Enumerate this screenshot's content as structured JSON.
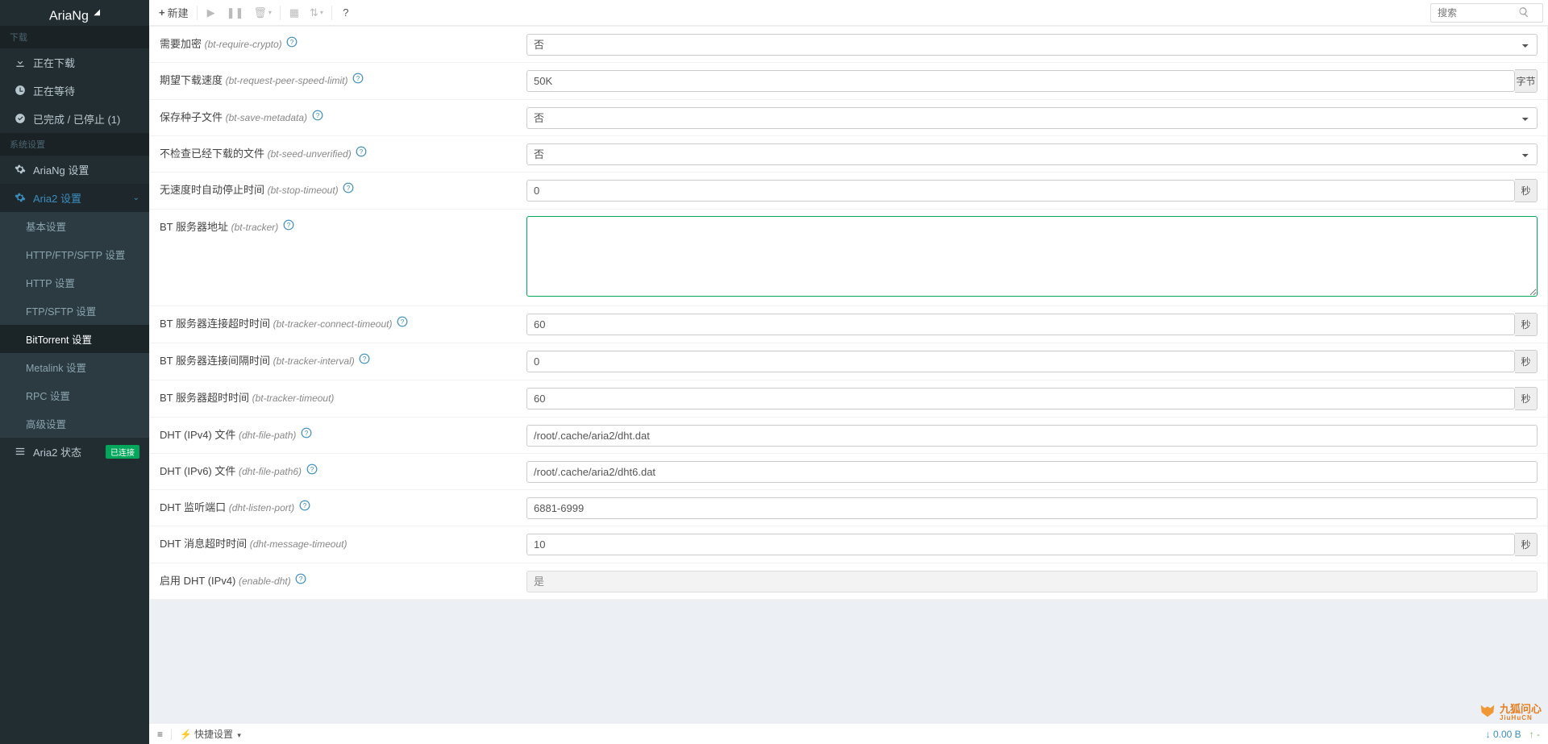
{
  "app": {
    "name": "AriaNg",
    "sublogo": "◢"
  },
  "sidebar": {
    "hdr_downloads": "下载",
    "items_downloads": [
      {
        "label": "正在下载",
        "icon": "download"
      },
      {
        "label": "正在等待",
        "icon": "clock"
      },
      {
        "label": "已完成 / 已停止 (1)",
        "icon": "check"
      }
    ],
    "hdr_system": "系统设置",
    "items_system": [
      {
        "label": "AriaNg 设置",
        "icon": "gear"
      },
      {
        "label": "Aria2 设置",
        "icon": "gear",
        "expanded": true
      },
      {
        "label": "Aria2 状态",
        "icon": "bars",
        "badge": "已连接"
      }
    ],
    "aria2_submenu": [
      "基本设置",
      "HTTP/FTP/SFTP 设置",
      "HTTP 设置",
      "FTP/SFTP 设置",
      "BitTorrent 设置",
      "Metalink 设置",
      "RPC 设置",
      "高级设置"
    ]
  },
  "topbar": {
    "new": "新建",
    "search_placeholder": "搜索"
  },
  "settings": [
    {
      "title": "需要加密",
      "opt": "(bt-require-crypto)",
      "help": true,
      "type": "select",
      "value": "否"
    },
    {
      "title": "期望下载速度",
      "opt": "(bt-request-peer-speed-limit)",
      "help": true,
      "type": "text",
      "value": "50K",
      "unit": "字节"
    },
    {
      "title": "保存种子文件",
      "opt": "(bt-save-metadata)",
      "help": true,
      "type": "select",
      "value": "否"
    },
    {
      "title": "不检查已经下载的文件",
      "opt": "(bt-seed-unverified)",
      "help": true,
      "type": "select",
      "value": "否"
    },
    {
      "title": "无速度时自动停止时间",
      "opt": "(bt-stop-timeout)",
      "help": true,
      "type": "text",
      "value": "0",
      "unit": "秒"
    },
    {
      "title": "BT 服务器地址",
      "opt": "(bt-tracker)",
      "help": true,
      "type": "textarea",
      "value": "",
      "highlight": true
    },
    {
      "title": "BT 服务器连接超时时间",
      "opt": "(bt-tracker-connect-timeout)",
      "help": true,
      "type": "text",
      "value": "60",
      "unit": "秒"
    },
    {
      "title": "BT 服务器连接间隔时间",
      "opt": "(bt-tracker-interval)",
      "help": true,
      "type": "text",
      "value": "0",
      "unit": "秒"
    },
    {
      "title": "BT 服务器超时时间",
      "opt": "(bt-tracker-timeout)",
      "help": false,
      "type": "text",
      "value": "60",
      "unit": "秒"
    },
    {
      "title": "DHT (IPv4) 文件",
      "opt": "(dht-file-path)",
      "help": true,
      "type": "readonly",
      "value": "/root/.cache/aria2/dht.dat"
    },
    {
      "title": "DHT (IPv6) 文件",
      "opt": "(dht-file-path6)",
      "help": true,
      "type": "readonly",
      "value": "/root/.cache/aria2/dht6.dat"
    },
    {
      "title": "DHT 监听端口",
      "opt": "(dht-listen-port)",
      "help": true,
      "type": "readonly",
      "value": "6881-6999"
    },
    {
      "title": "DHT 消息超时时间",
      "opt": "(dht-message-timeout)",
      "help": false,
      "type": "readonly",
      "value": "10",
      "unit": "秒"
    },
    {
      "title": "启用 DHT (IPv4)",
      "opt": "(enable-dht)",
      "help": true,
      "type": "select-ro",
      "value": "是"
    }
  ],
  "footer": {
    "quick": "快捷设置",
    "down": "0.00 B",
    "up": "-"
  },
  "watermark": {
    "brand": "九狐问心",
    "sub": "JiuHuCN"
  }
}
